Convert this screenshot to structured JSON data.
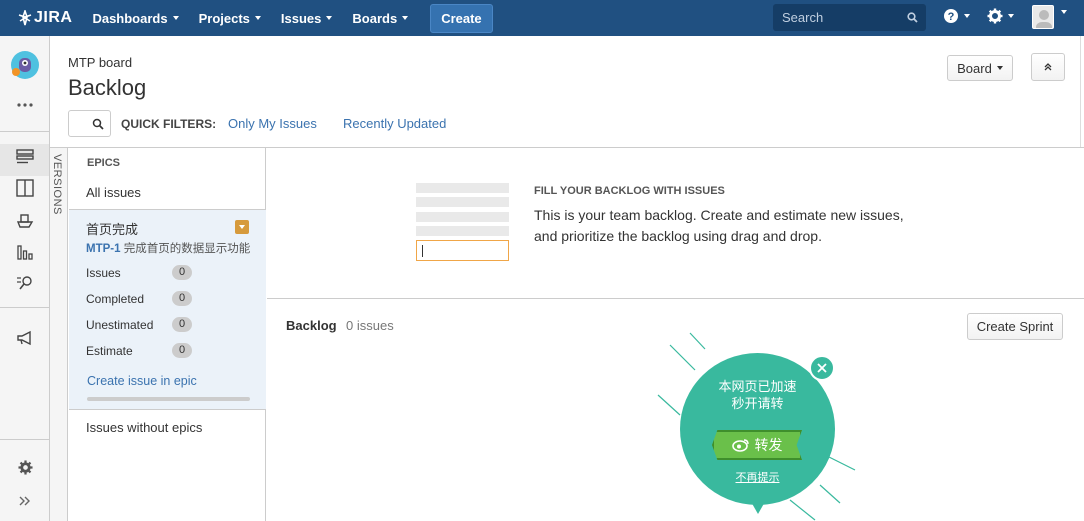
{
  "topnav": {
    "logo": "JIRA",
    "items": [
      {
        "label": "Dashboards"
      },
      {
        "label": "Projects"
      },
      {
        "label": "Issues"
      },
      {
        "label": "Boards"
      }
    ],
    "create_label": "Create",
    "search_placeholder": "Search",
    "brand_color": "#205081"
  },
  "header": {
    "breadcrumb": "MTP board",
    "title": "Backlog",
    "board_button": "Board"
  },
  "quick_filters": {
    "label": "QUICK FILTERS:",
    "items": [
      "Only My Issues",
      "Recently Updated"
    ]
  },
  "sidebar": {
    "versions_tab": "VERSIONS"
  },
  "epics": {
    "title": "EPICS",
    "all_issues": "All issues",
    "epic": {
      "name": "首页完成",
      "key": "MTP-1",
      "summary": "完成首页的数据显示功能",
      "stats": [
        {
          "label": "Issues",
          "value": "0"
        },
        {
          "label": "Completed",
          "value": "0"
        },
        {
          "label": "Unestimated",
          "value": "0"
        },
        {
          "label": "Estimate",
          "value": "0"
        }
      ],
      "create_link": "Create issue in epic"
    },
    "without_epics": "Issues without epics"
  },
  "empty_state": {
    "title": "FILL YOUR BACKLOG WITH ISSUES",
    "line1": "This is your team backlog. Create and estimate new issues,",
    "line2": "and prioritize the backlog using drag and drop."
  },
  "backlog": {
    "title": "Backlog",
    "count": "0 issues",
    "create_sprint": "Create Sprint"
  },
  "popup": {
    "line1": "本网页已加速",
    "line2": "秒开请转",
    "share": "转发",
    "dismiss": "不再提示",
    "color": "#39b99e"
  }
}
